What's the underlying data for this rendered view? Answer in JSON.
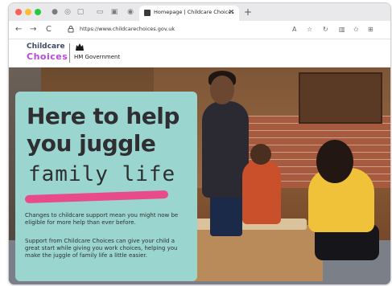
{
  "browser": {
    "traffic_light_colors": [
      "#fe5f57",
      "#febc2e",
      "#28c840"
    ],
    "tab": {
      "title": "Homepage | Childcare Choices",
      "close": "×"
    },
    "new_tab": "+",
    "url": "https://www.childcarechoices.gov.uk",
    "nav": {
      "back": "←",
      "forward": "→",
      "reload": "C"
    }
  },
  "site": {
    "logo": {
      "line1": "Childcare",
      "line2": "Choices"
    },
    "government": "HM Government"
  },
  "hero": {
    "heading": "Here to help you juggle",
    "handwritten": "family life",
    "paragraph1": "Changes to childcare support mean you might now be eligible for more help than ever before.",
    "paragraph2": "Support from Childcare Choices can give your child a great start while giving you work choices, helping you make the juggle of family life a little easier.",
    "card_color": "#9ad6cf",
    "underline_color": "#e84a8a"
  }
}
